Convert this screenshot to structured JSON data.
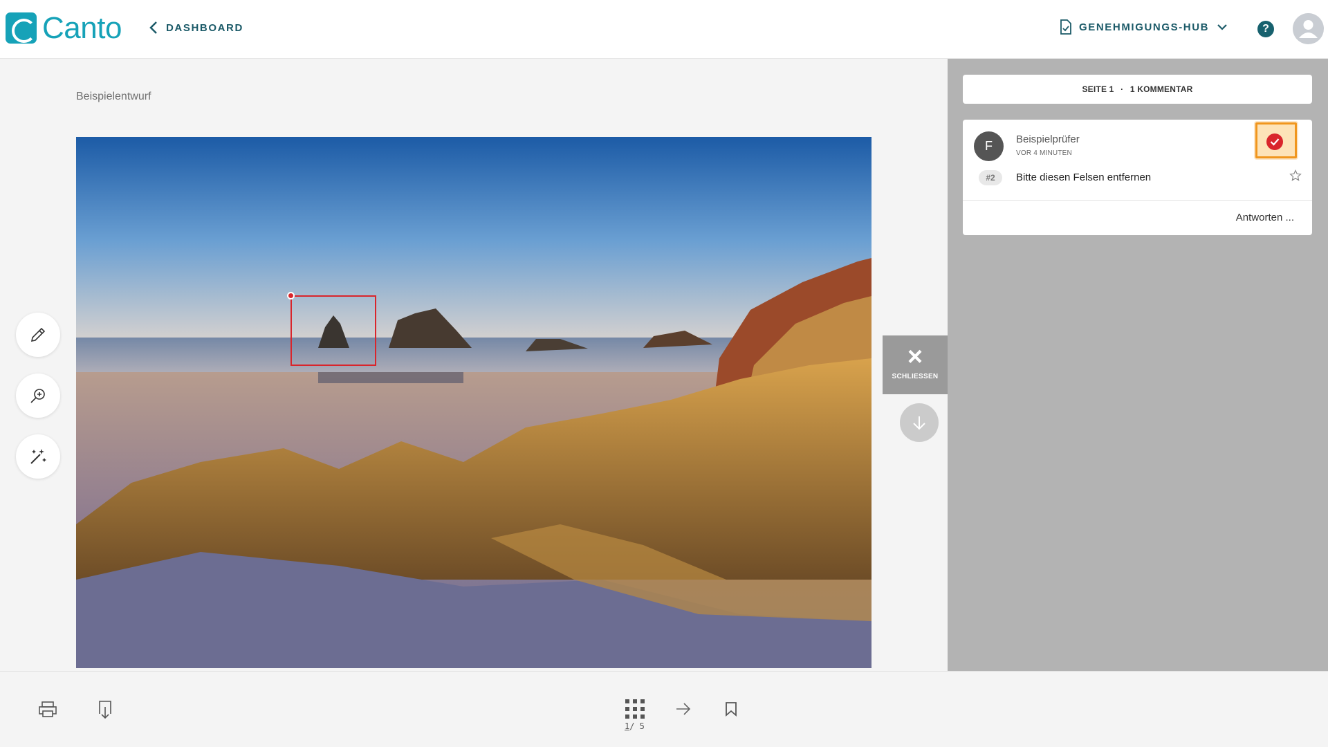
{
  "header": {
    "logo_text": "Canto",
    "back_label": "DASHBOARD",
    "hub_label": "GENEHMIGUNGS-HUB",
    "help_label": "?"
  },
  "main": {
    "draft_title": "Beispielentwurf"
  },
  "overlay": {
    "close_icon": "×",
    "close_label": "SCHLIESSEN"
  },
  "panel": {
    "page_label": "SEITE 1",
    "separator": "·",
    "comment_count": "1 KOMMENTAR",
    "comment": {
      "avatar_initial": "F",
      "author": "Beispielprüfer",
      "time": "VOR 4 MINUTEN",
      "number": "#2",
      "text": "Bitte diesen Felsen entfernen",
      "reply_label": "Antworten ..."
    }
  },
  "footer": {
    "current_page": "1",
    "total_pages": "/ 5"
  },
  "icons": {
    "tools": [
      "pencil-icon",
      "zoom-in-icon",
      "magic-wand-icon"
    ],
    "footer": [
      "print-icon",
      "download-icon",
      "grid-icon",
      "arrow-right-icon",
      "bookmark-icon"
    ]
  },
  "colors": {
    "brand": "#16a2b8",
    "accent_dark": "#1b5a68",
    "markup_red": "#d9252b",
    "highlight_orange": "#f0961e"
  }
}
